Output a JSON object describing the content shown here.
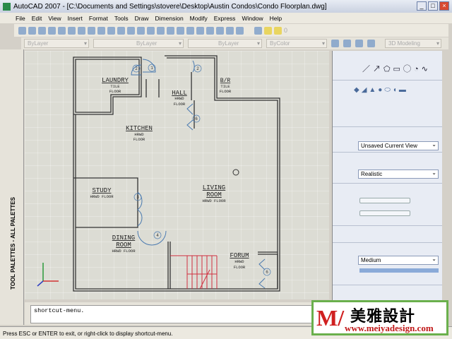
{
  "window": {
    "title": "AutoCAD 2007 - [C:\\Documents and Settings\\stovere\\Desktop\\Austin Condos\\Condo Floorplan.dwg]"
  },
  "menu": [
    "File",
    "Edit",
    "View",
    "Insert",
    "Format",
    "Tools",
    "Draw",
    "Dimension",
    "Modify",
    "Express",
    "Window",
    "Help"
  ],
  "properties": {
    "color": "ByLayer",
    "linetype": "ByLayer",
    "lineweight": "ByLayer",
    "plotstyle": "ByColor",
    "workspace": "3D Modeling",
    "layer_num": "0"
  },
  "palette": {
    "label": "TOOL PALETTES - ALL PALETTES"
  },
  "floorplan": {
    "rooms": [
      {
        "name": "LAUNDRY",
        "floor": [
          "TILE",
          "FLOOR"
        ]
      },
      {
        "name": "HALL",
        "floor": [
          "HRWD",
          "FLOOR"
        ]
      },
      {
        "name": "B/R",
        "floor": [
          "TILE",
          "FLOOR"
        ]
      },
      {
        "name": "KITCHEN",
        "floor": [
          "HRWD",
          "FLOOR"
        ]
      },
      {
        "name": "STUDY",
        "floor": [
          "HRWD FLOOR"
        ]
      },
      {
        "name": "LIVING",
        "name2": "ROOM",
        "floor": [
          "HRWD FLOOR"
        ]
      },
      {
        "name": "DINING",
        "name2": "ROOM",
        "floor": [
          "HRWD FLOOR"
        ]
      },
      {
        "name": "FORUM",
        "floor": [
          "HRWD",
          "FLOOR"
        ]
      }
    ],
    "tags": [
      "1",
      "2",
      "2",
      "6",
      "3",
      "4",
      "6"
    ]
  },
  "dashboard": {
    "view": "Unsaved Current View",
    "visual_style": "Realistic",
    "material": "Medium"
  },
  "command": {
    "line": "shortcut-menu."
  },
  "status": {
    "text": "Press ESC or ENTER to exit, or right-click to display shortcut-menu."
  },
  "watermark": {
    "chinese": "美雅設計",
    "url": "www.meiyadesign.com"
  }
}
